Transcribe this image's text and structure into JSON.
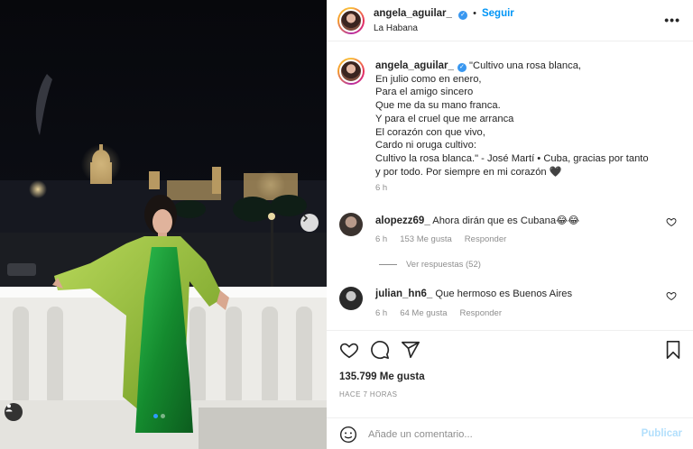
{
  "post": {
    "username": "angela_aguilar_",
    "follow_label": "Seguir",
    "location": "La Habana",
    "more_label": "•••"
  },
  "caption": {
    "username": "angela_aguilar_",
    "lines": [
      "\"Cultivo una rosa blanca,",
      "En julio como en enero,",
      "Para el amigo sincero",
      "Que me da su mano franca.",
      "Y para el cruel que me arranca",
      "El corazón con que vivo,",
      "Cardo ni oruga cultivo:",
      "Cultivo la rosa blanca.\" - José Martí • Cuba, gracias por tanto",
      "y por todo. Por siempre en mi corazón 🖤"
    ],
    "time": "6 h"
  },
  "comments": [
    {
      "username": "alopezz69_",
      "text": "Ahora dirán que es Cubana😂😂",
      "time": "6 h",
      "likes": "153 Me gusta",
      "reply_label": "Responder"
    },
    {
      "username": "julian_hn6_",
      "text": "Que hermoso es Buenos Aires",
      "time": "6 h",
      "likes": "64 Me gusta",
      "reply_label": "Responder"
    }
  ],
  "view_replies": "Ver respuestas (52)",
  "likes_count": "135.799 Me gusta",
  "posted_ago": "HACE 7 HORAS",
  "comment_input": {
    "placeholder": "Añade un comentario...",
    "publish_label": "Publicar"
  },
  "carousel": {
    "slides": 2,
    "active_slide": 1
  },
  "colors": {
    "accent": "#0095f6",
    "verified": "#3897f0",
    "dress": "#1f9a3a",
    "kimono": "#9bc43a",
    "meta_text": "#8e8e8e"
  },
  "icons": [
    "heart-icon",
    "comment-icon",
    "share-icon",
    "bookmark-icon",
    "emoji-icon",
    "tag-user-icon",
    "chevron-right-icon",
    "verified-icon"
  ]
}
